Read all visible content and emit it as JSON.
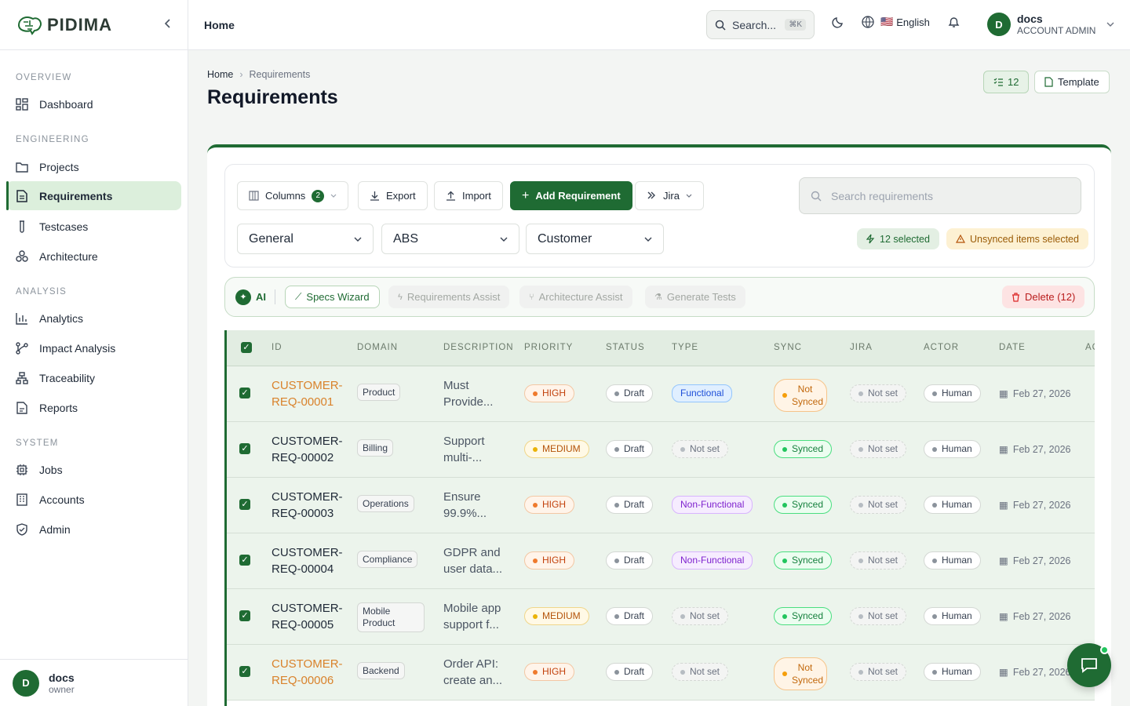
{
  "app": {
    "logo_text": "PIDIMA"
  },
  "sidebar": {
    "sections": [
      {
        "title": "OVERVIEW",
        "items": [
          {
            "label": "Dashboard",
            "icon": "dashboard-icon"
          }
        ]
      },
      {
        "title": "ENGINEERING",
        "items": [
          {
            "label": "Projects",
            "icon": "folder-icon"
          },
          {
            "label": "Requirements",
            "icon": "document-icon",
            "active": true
          },
          {
            "label": "Testcases",
            "icon": "test-tube-icon"
          },
          {
            "label": "Architecture",
            "icon": "architecture-icon"
          }
        ]
      },
      {
        "title": "ANALYSIS",
        "items": [
          {
            "label": "Analytics",
            "icon": "bar-chart-icon"
          },
          {
            "label": "Impact Analysis",
            "icon": "branch-icon"
          },
          {
            "label": "Traceability",
            "icon": "network-icon"
          },
          {
            "label": "Reports",
            "icon": "report-icon"
          }
        ]
      },
      {
        "title": "SYSTEM",
        "items": [
          {
            "label": "Jobs",
            "icon": "cpu-icon"
          },
          {
            "label": "Accounts",
            "icon": "building-icon"
          },
          {
            "label": "Admin",
            "icon": "shield-icon"
          }
        ]
      }
    ],
    "footer": {
      "avatar": "D",
      "name": "docs",
      "role": "owner"
    }
  },
  "topbar": {
    "title": "Home",
    "search_label": "Search...",
    "search_kbd": "⌘K",
    "language": "English",
    "language_flag": "🇺🇸",
    "user": {
      "avatar": "D",
      "name": "docs",
      "role": "ACCOUNT ADMIN"
    }
  },
  "page": {
    "breadcrumb": [
      "Home",
      "Requirements"
    ],
    "title": "Requirements",
    "count_button": "12",
    "template_button": "Template"
  },
  "toolbar": {
    "columns_label": "Columns",
    "columns_count": "2",
    "export_label": "Export",
    "import_label": "Import",
    "add_label": "Add Requirement",
    "jira_label": "Jira",
    "search_placeholder": "Search requirements",
    "filters": [
      "General",
      "ABS",
      "Customer"
    ],
    "selected_label": "12 selected",
    "unsynced_label": "Unsynced items selected"
  },
  "ai_bar": {
    "ai_label": "AI",
    "specs_wizard": "Specs Wizard",
    "requirements_assist": "Requirements Assist",
    "architecture_assist": "Architecture Assist",
    "generate_tests": "Generate Tests",
    "delete_label": "Delete (12)"
  },
  "table": {
    "headers": [
      "ID",
      "DOMAIN",
      "DESCRIPTION",
      "PRIORITY",
      "STATUS",
      "TYPE",
      "SYNC",
      "JIRA",
      "ACTOR",
      "DATE",
      "AC"
    ],
    "rows": [
      {
        "id1": "CUSTOMER-",
        "id2": "REQ-00001",
        "domain": "Product",
        "desc1": "Must",
        "desc2": "Provide...",
        "priority": "HIGH",
        "status": "Draft",
        "type": "Functional",
        "sync": "Not Synced",
        "jira": "Not set",
        "actor": "Human",
        "date": "Feb 27, 2026"
      },
      {
        "id1": "CUSTOMER-",
        "id2": "REQ-00002",
        "domain": "Billing",
        "desc1": "Support",
        "desc2": "multi-...",
        "priority": "MEDIUM",
        "status": "Draft",
        "type": "Not set",
        "sync": "Synced",
        "jira": "Not set",
        "actor": "Human",
        "date": "Feb 27, 2026"
      },
      {
        "id1": "CUSTOMER-",
        "id2": "REQ-00003",
        "domain": "Operations",
        "desc1": "Ensure",
        "desc2": "99.9%...",
        "priority": "HIGH",
        "status": "Draft",
        "type": "Non-Functional",
        "sync": "Synced",
        "jira": "Not set",
        "actor": "Human",
        "date": "Feb 27, 2026"
      },
      {
        "id1": "CUSTOMER-",
        "id2": "REQ-00004",
        "domain": "Compliance",
        "desc1": "GDPR and",
        "desc2": "user data...",
        "priority": "HIGH",
        "status": "Draft",
        "type": "Non-Functional",
        "sync": "Synced",
        "jira": "Not set",
        "actor": "Human",
        "date": "Feb 27, 2026"
      },
      {
        "id1": "CUSTOMER-",
        "id2": "REQ-00005",
        "domain1": "Mobile",
        "domain2": "Product",
        "desc1": "Mobile app",
        "desc2": "support f...",
        "priority": "MEDIUM",
        "status": "Draft",
        "type": "Not set",
        "sync": "Synced",
        "jira": "Not set",
        "actor": "Human",
        "date": "Feb 27, 2026"
      },
      {
        "id1": "CUSTOMER-",
        "id2": "REQ-00006",
        "domain": "Backend",
        "desc1": "Order API:",
        "desc2": "create an...",
        "priority": "HIGH",
        "status": "Draft",
        "type": "Not set",
        "sync": "Not Synced",
        "jira": "Not set",
        "actor": "Human",
        "date": "Feb 27, 2026"
      }
    ]
  },
  "colors": {
    "brand": "#1f6b33",
    "high": "#c2410c",
    "medium": "#b45309",
    "synced": "#15803d",
    "not_synced": "#d9822b"
  }
}
